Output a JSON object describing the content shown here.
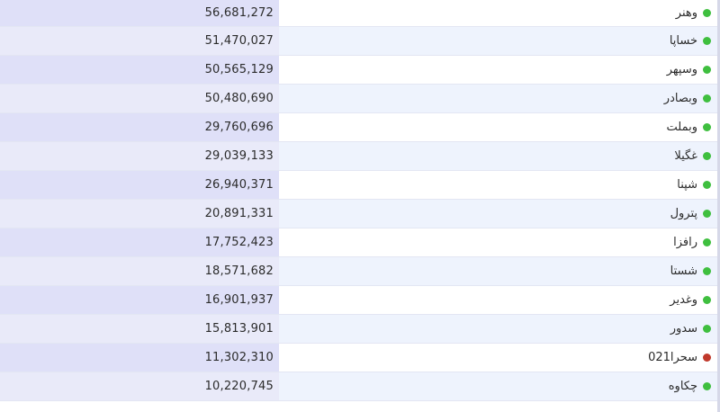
{
  "colors": {
    "positive": "#3fbf3f",
    "negative": "#c0392b"
  },
  "rows": [
    {
      "name": "وهنر",
      "value": "56,681,272",
      "status": "positive"
    },
    {
      "name": "خساپا",
      "value": "51,470,027",
      "status": "positive"
    },
    {
      "name": "وسپهر",
      "value": "50,565,129",
      "status": "positive"
    },
    {
      "name": "وبصادر",
      "value": "50,480,690",
      "status": "positive"
    },
    {
      "name": "وبملت",
      "value": "29,760,696",
      "status": "positive"
    },
    {
      "name": "غگیلا",
      "value": "29,039,133",
      "status": "positive"
    },
    {
      "name": "شپنا",
      "value": "26,940,371",
      "status": "positive"
    },
    {
      "name": "پترول",
      "value": "20,891,331",
      "status": "positive"
    },
    {
      "name": "رافزا",
      "value": "17,752,423",
      "status": "positive"
    },
    {
      "name": "شستا",
      "value": "18,571,682",
      "status": "positive"
    },
    {
      "name": "وغدیر",
      "value": "16,901,937",
      "status": "positive"
    },
    {
      "name": "سدور",
      "value": "15,813,901",
      "status": "positive"
    },
    {
      "name": "سحرا021",
      "value": "11,302,310",
      "status": "negative"
    },
    {
      "name": "چکاوه",
      "value": "10,220,745",
      "status": "positive"
    }
  ]
}
